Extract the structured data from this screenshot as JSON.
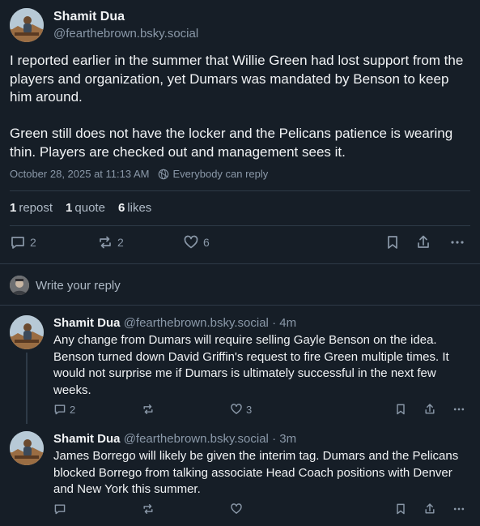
{
  "main_post": {
    "author_name": "Shamit Dua",
    "author_handle": "@fearthebrown.bsky.social",
    "paragraph_1": "I reported earlier in the summer that Willie Green had lost support from the players and organization, yet Dumars was mandated by Benson to keep him around.",
    "paragraph_2": "Green still does not have the locker and the Pelicans patience is wearing thin. Players are checked out and management sees it.",
    "timestamp": "October 28, 2025 at 11:13 AM",
    "visibility": "Everybody can reply",
    "stats": {
      "reposts_count": "1",
      "reposts_label": "repost",
      "quotes_count": "1",
      "quotes_label": "quote",
      "likes_count": "6",
      "likes_label": "likes"
    },
    "actions": {
      "reply_count": "2",
      "repost_count": "2",
      "like_count": "6"
    }
  },
  "composer": {
    "placeholder": "Write your reply"
  },
  "replies": [
    {
      "author_name": "Shamit Dua",
      "author_handle": "@fearthebrown.bsky.social",
      "time": "· 4m",
      "text": "Any change from Dumars will require selling Gayle Benson on the idea. Benson turned down David Griffin's request to fire Green multiple times. It would not surprise me if Dumars is ultimately successful in the next few weeks.",
      "reply_count": "2",
      "repost_count": "",
      "like_count": "3"
    },
    {
      "author_name": "Shamit Dua",
      "author_handle": "@fearthebrown.bsky.social",
      "time": "· 3m",
      "text": "James Borrego will likely be given the interim tag. Dumars and the Pelicans blocked Borrego from talking associate Head Coach positions with Denver and New York this summer.",
      "reply_count": "",
      "repost_count": "",
      "like_count": ""
    }
  ],
  "icons": {
    "reply": "speech-bubble-icon",
    "repost": "repost-arrows-icon",
    "like": "heart-icon",
    "bookmark": "bookmark-icon",
    "share": "share-upload-icon",
    "more": "more-dots-icon",
    "visibility": "globe-icon"
  },
  "colors": {
    "background": "#161e27",
    "text": "#f1f3f5",
    "muted": "#8a98a8",
    "divider": "#2e3a47"
  }
}
